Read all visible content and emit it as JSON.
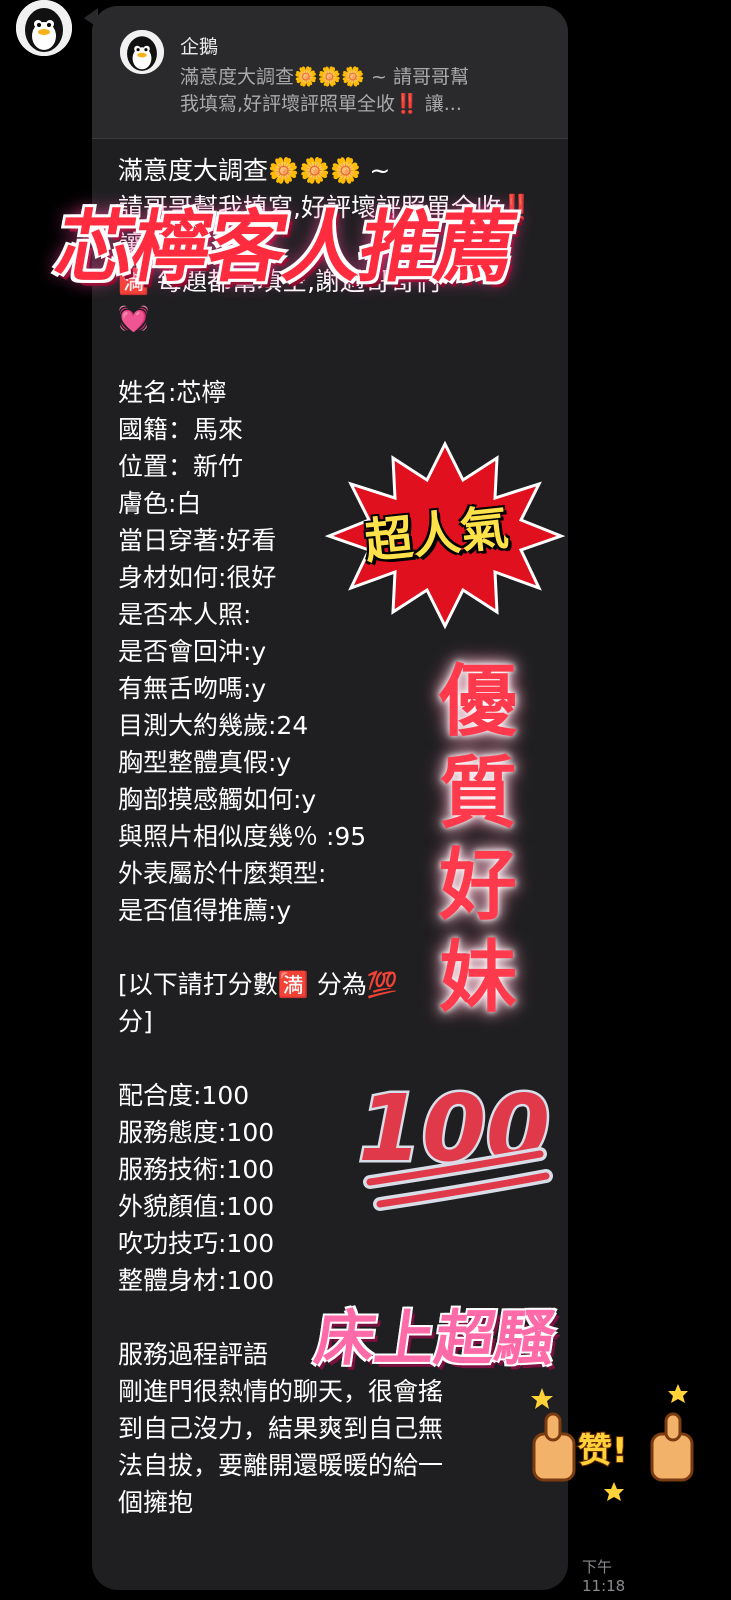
{
  "quote": {
    "sender_name": "企鵝",
    "preview_text": "滿意度大調查🌼🌼🌼 ~ 請哥哥幫\n我填寫,好評壞評照單全收‼️ 讓..."
  },
  "message": {
    "body": "滿意度大調查🌼🌼🌼 ~\n請哥哥幫我填寫,好評壞評照單全收‼️ 讓\n🈵 每題都幫填空,謝過哥哥們\n💓\n\n姓名:芯檸\n國籍：馬來\n位置：新竹\n膚色:白\n當日穿著:好看\n身材如何:很好\n是否本人照:\n是否會回沖:y\n有無舌吻嗎:y\n目測大約幾歲:24\n胸型整體真假:y\n胸部摸感觸如何:y\n與照片相似度幾％ :95\n外表屬於什麼類型:\n是否值得推薦:y\n\n  [以下請打分數🈵 分為💯\n分]\n\n配合度:100\n服務態度:100\n服務技術:100\n外貌顏值:100\n吹功技巧:100\n整體身材:100\n\n服務過程評語\n剛進門很熱情的聊天，很會搖\n到自己沒力，結果爽到自己無\n法自拔，要離開還暖暖的給一\n個擁抱",
    "time": "下午 11:18"
  },
  "overlays": {
    "title": "芯檸客人推薦",
    "popular": "超人氣",
    "quality": "優質好妹",
    "hundred": "100",
    "bed": "床上超騷",
    "thumbs": "赞!"
  }
}
